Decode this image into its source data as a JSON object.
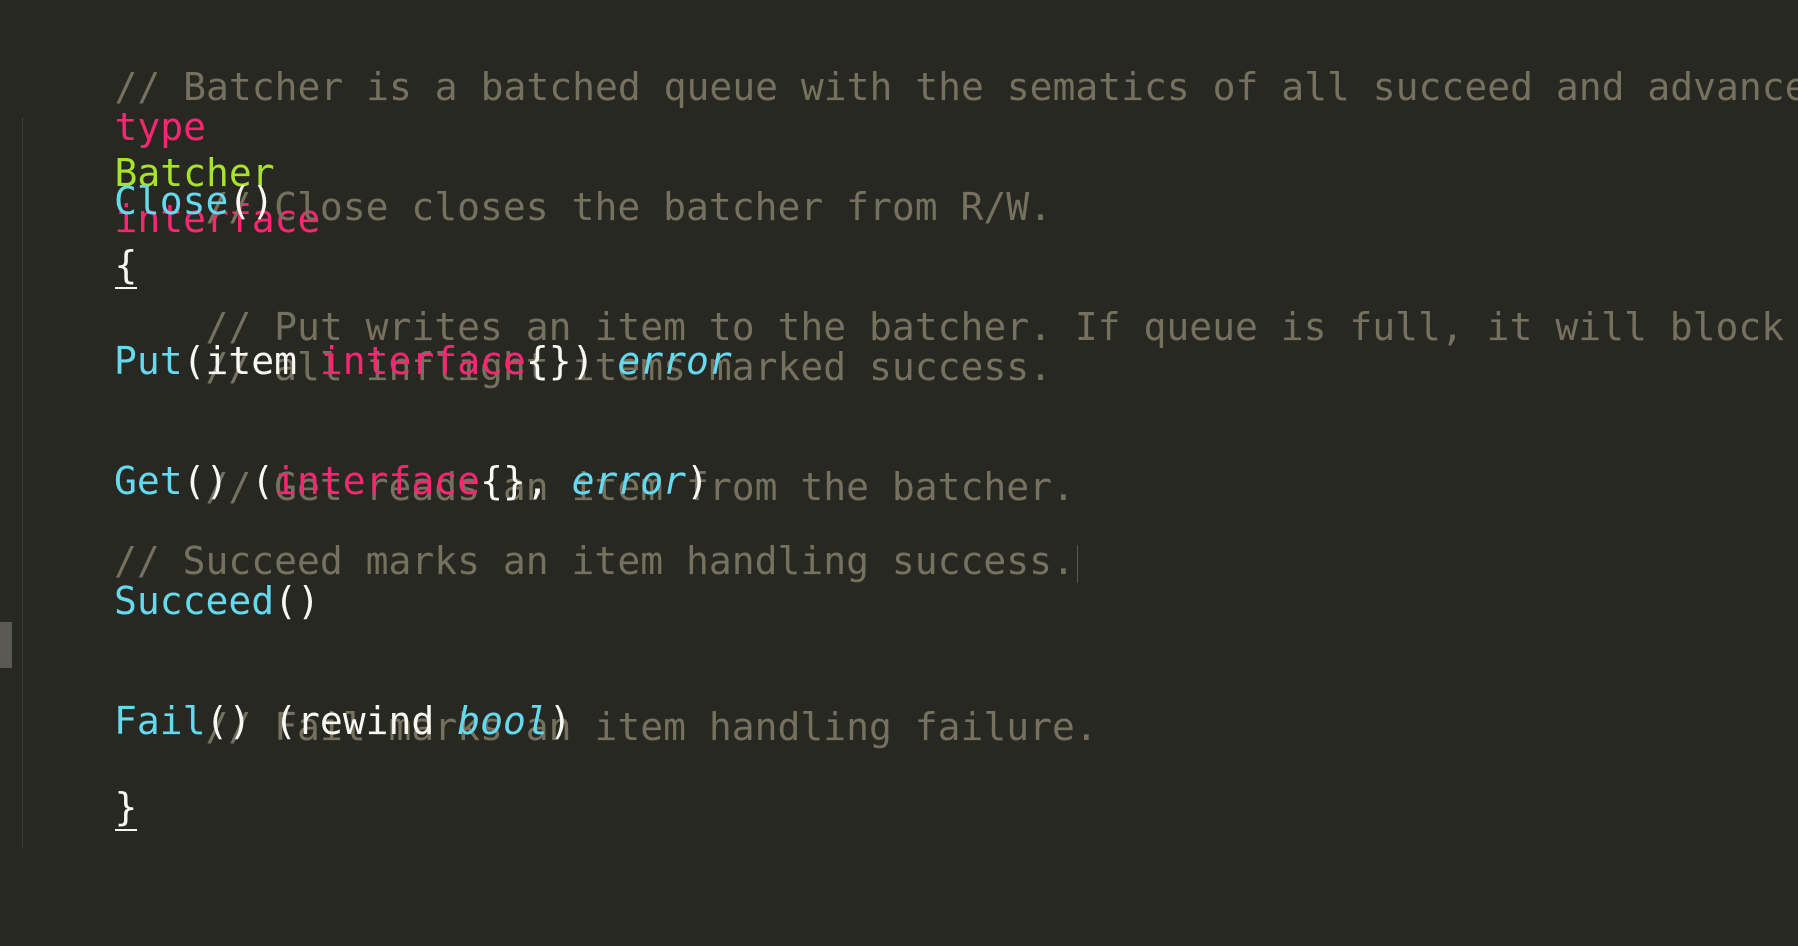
{
  "code": {
    "header_comment": "// Batcher is a batched queue with the sematics of all succeed and advance or",
    "decl": {
      "kw_type": "type",
      "name": "Batcher",
      "kw_interface": "interface",
      "open": "{"
    },
    "close_comment": "// Close closes the batcher from R/W.",
    "close_sig": {
      "name": "Close",
      "parens": "()"
    },
    "put_comment_1": "// Put writes an item to the batcher. If queue is full, it will block till",
    "put_comment_2": "// all inflight items marked success.",
    "put_sig": {
      "name": "Put",
      "open": "(",
      "param": "item ",
      "kw": "interface",
      "rest": "{})",
      "ret": "error"
    },
    "get_comment": "// Get reads an item from the batcher.",
    "get_sig": {
      "name": "Get",
      "mid": "() (",
      "kw": "interface",
      "braces": "{}, ",
      "ret": "error",
      "close": ")"
    },
    "succeed_comment": "// Succeed marks an item handling success.",
    "succeed_sig": {
      "name": "Succeed",
      "parens": "()"
    },
    "fail_comment": "// Fail marks an item handling failure.",
    "fail_sig": {
      "name": "Fail",
      "mid": "() (rewind ",
      "ret": "bool",
      "close": ")"
    },
    "close_brace": "}"
  }
}
